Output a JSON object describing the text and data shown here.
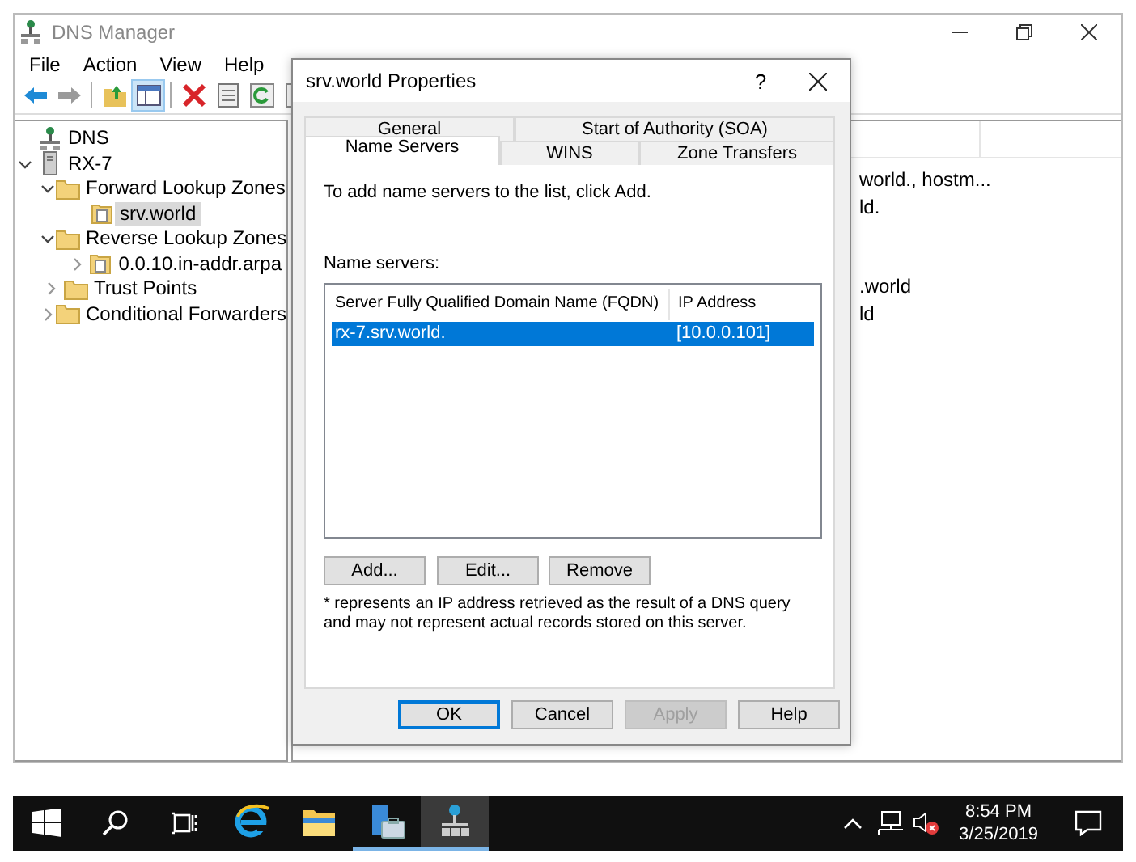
{
  "window": {
    "title": "DNS Manager"
  },
  "menu": [
    "File",
    "Action",
    "View",
    "Help"
  ],
  "tree": [
    {
      "label": "DNS",
      "kind": "dns",
      "selected": false,
      "children": [
        {
          "label": "RX-7",
          "kind": "server",
          "expanded": true,
          "selected": false,
          "children": [
            {
              "label": "Forward Lookup Zones",
              "kind": "folder",
              "expanded": true,
              "selected": false,
              "children": [
                {
                  "label": "srv.world",
                  "kind": "zone",
                  "selected": true
                }
              ]
            },
            {
              "label": "Reverse Lookup Zones",
              "kind": "folder",
              "expanded": true,
              "selected": false,
              "children": [
                {
                  "label": "0.0.10.in-addr.arpa",
                  "kind": "zone",
                  "expanded": false,
                  "selected": false
                }
              ]
            },
            {
              "label": "Trust Points",
              "kind": "folder",
              "expanded": false,
              "selected": false
            },
            {
              "label": "Conditional Forwarders",
              "kind": "folder",
              "expanded": false,
              "selected": false
            }
          ]
        }
      ]
    }
  ],
  "list": {
    "rows": [
      "world., hostm...",
      "ld.",
      ".world",
      "ld"
    ]
  },
  "dialog": {
    "title": "srv.world Properties",
    "help": "?",
    "tab_rows": [
      [
        {
          "label": "General",
          "selected": false
        },
        {
          "label": "Start of Authority (SOA)",
          "selected": false
        }
      ],
      [
        {
          "label": "Name Servers",
          "selected": true
        },
        {
          "label": "WINS",
          "selected": false
        },
        {
          "label": "Zone Transfers",
          "selected": false
        }
      ]
    ],
    "instruction": "To add name servers to the list, click Add.",
    "list_label": "Name servers:",
    "table": {
      "columns": [
        "Server Fully Qualified Domain Name (FQDN)",
        "IP Address"
      ],
      "rows": [
        {
          "cells": [
            "rx-7.srv.world.",
            "[10.0.0.101]"
          ],
          "selected": true
        }
      ]
    },
    "list_buttons": [
      "Add...",
      "Edit...",
      "Remove"
    ],
    "note": "* represents an IP address retrieved as the result of a DNS query and may not represent actual records stored on this server.",
    "buttons": [
      {
        "label": "OK",
        "default": true,
        "disabled": false
      },
      {
        "label": "Cancel",
        "default": false,
        "disabled": false
      },
      {
        "label": "Apply",
        "default": false,
        "disabled": true
      },
      {
        "label": "Help",
        "default": false,
        "disabled": false
      }
    ]
  },
  "taskbar": {
    "apps": [
      {
        "kind": "browser",
        "running": false,
        "selected": false
      },
      {
        "kind": "folder",
        "running": false,
        "selected": false
      },
      {
        "kind": "server-manager",
        "running": true,
        "selected": false
      },
      {
        "kind": "dns",
        "running": true,
        "selected": true
      }
    ],
    "time": "8:54 PM",
    "date": "3/25/2019"
  }
}
